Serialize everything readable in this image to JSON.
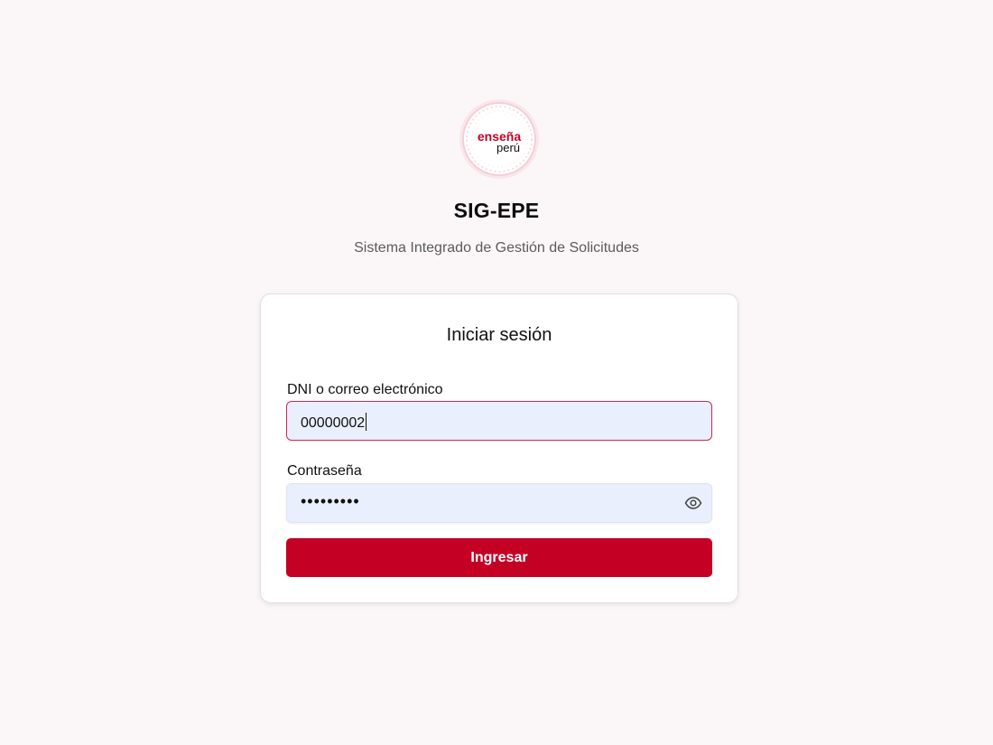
{
  "brand": {
    "logo_line1": "enseña",
    "logo_line2": "perú",
    "accent_color": "#c40025"
  },
  "header": {
    "app_title": "SIG-EPE",
    "app_subtitle": "Sistema Integrado de Gestión de Solicitudes"
  },
  "login_card": {
    "title": "Iniciar sesión",
    "username_label": "DNI o correo electrónico",
    "username_value": "00000002",
    "password_label": "Contraseña",
    "password_masked": "•••••••••",
    "toggle_icon": "eye-icon",
    "submit_label": "Ingresar"
  }
}
